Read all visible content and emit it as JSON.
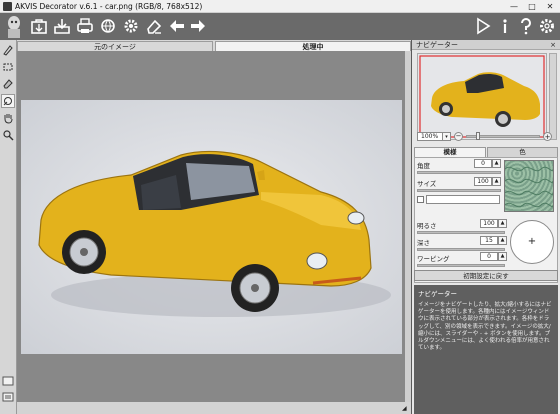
{
  "window": {
    "title": "AKVIS Decorator v.6.1 - car.png (RGB/8, 768x512)",
    "minimize": "—",
    "maximize": "□",
    "close": "✕"
  },
  "toolbar": {
    "left_icons": [
      "akvis-logo-icon",
      "open-file-icon",
      "save-file-icon",
      "print-icon",
      "share-icon",
      "settings-gear-icon",
      "undo-icon",
      "redo-icon"
    ],
    "right_icons": [
      "run-icon",
      "info-icon",
      "help-icon",
      "preferences-icon"
    ]
  },
  "left_tools": [
    "selection-brush-icon",
    "lasso-icon",
    "eraser-icon",
    "magic-wand-icon",
    "hand-icon",
    "zoom-icon"
  ],
  "view_tabs": {
    "before": "元のイメージ",
    "after": "処理中"
  },
  "navigator": {
    "title": "ナビゲーター",
    "close": "×",
    "zoom_value": "100%",
    "zoom_out": "−",
    "zoom_in": "+"
  },
  "settings_tabs": {
    "pattern": "模様",
    "color": "色"
  },
  "settings": {
    "angle_label": "角度",
    "angle_value": "0",
    "size_label": "サイズ",
    "size_value": "100",
    "brightness_label": "明るさ",
    "brightness_value": "100",
    "depth_label": "深さ",
    "depth_value": "15",
    "warping_label": "ワーピング",
    "warping_value": "0",
    "reset_button": "初期設定に戻す"
  },
  "hint": {
    "title": "ナビゲーター",
    "text": "イメージをナビゲートしたり、拡大/縮小するにはナビゲーターを使用します。各種内にはイメージウィンドウに表示されている部分が表示されます。各枠をドラッグして、別の領域を表示できます。イメージの拡大/縮小には、スライダーや - + ボタンを使用します。プルダウンメニューには、よく使われる倍率が用意されています。"
  },
  "colors": {
    "car_yellow": "#e3b21c",
    "panel_bg": "#e7e7e7",
    "toolbar_bg": "#6a6a6a"
  }
}
